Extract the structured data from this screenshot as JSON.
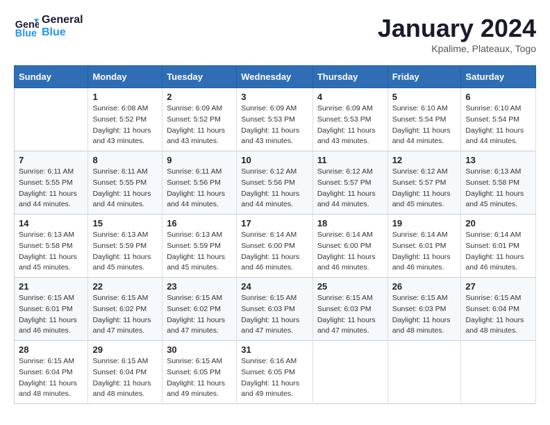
{
  "logo": {
    "line1": "General",
    "line2": "Blue"
  },
  "title": "January 2024",
  "subtitle": "Kpalime, Plateaux, Togo",
  "headers": [
    "Sunday",
    "Monday",
    "Tuesday",
    "Wednesday",
    "Thursday",
    "Friday",
    "Saturday"
  ],
  "weeks": [
    [
      {
        "day": "",
        "sunrise": "",
        "sunset": "",
        "daylight": ""
      },
      {
        "day": "1",
        "sunrise": "6:08 AM",
        "sunset": "5:52 PM",
        "daylight": "11 hours and 43 minutes."
      },
      {
        "day": "2",
        "sunrise": "6:09 AM",
        "sunset": "5:52 PM",
        "daylight": "11 hours and 43 minutes."
      },
      {
        "day": "3",
        "sunrise": "6:09 AM",
        "sunset": "5:53 PM",
        "daylight": "11 hours and 43 minutes."
      },
      {
        "day": "4",
        "sunrise": "6:09 AM",
        "sunset": "5:53 PM",
        "daylight": "11 hours and 43 minutes."
      },
      {
        "day": "5",
        "sunrise": "6:10 AM",
        "sunset": "5:54 PM",
        "daylight": "11 hours and 44 minutes."
      },
      {
        "day": "6",
        "sunrise": "6:10 AM",
        "sunset": "5:54 PM",
        "daylight": "11 hours and 44 minutes."
      }
    ],
    [
      {
        "day": "7",
        "sunrise": "6:11 AM",
        "sunset": "5:55 PM",
        "daylight": "11 hours and 44 minutes."
      },
      {
        "day": "8",
        "sunrise": "6:11 AM",
        "sunset": "5:55 PM",
        "daylight": "11 hours and 44 minutes."
      },
      {
        "day": "9",
        "sunrise": "6:11 AM",
        "sunset": "5:56 PM",
        "daylight": "11 hours and 44 minutes."
      },
      {
        "day": "10",
        "sunrise": "6:12 AM",
        "sunset": "5:56 PM",
        "daylight": "11 hours and 44 minutes."
      },
      {
        "day": "11",
        "sunrise": "6:12 AM",
        "sunset": "5:57 PM",
        "daylight": "11 hours and 44 minutes."
      },
      {
        "day": "12",
        "sunrise": "6:12 AM",
        "sunset": "5:57 PM",
        "daylight": "11 hours and 45 minutes."
      },
      {
        "day": "13",
        "sunrise": "6:13 AM",
        "sunset": "5:58 PM",
        "daylight": "11 hours and 45 minutes."
      }
    ],
    [
      {
        "day": "14",
        "sunrise": "6:13 AM",
        "sunset": "5:58 PM",
        "daylight": "11 hours and 45 minutes."
      },
      {
        "day": "15",
        "sunrise": "6:13 AM",
        "sunset": "5:59 PM",
        "daylight": "11 hours and 45 minutes."
      },
      {
        "day": "16",
        "sunrise": "6:13 AM",
        "sunset": "5:59 PM",
        "daylight": "11 hours and 45 minutes."
      },
      {
        "day": "17",
        "sunrise": "6:14 AM",
        "sunset": "6:00 PM",
        "daylight": "11 hours and 46 minutes."
      },
      {
        "day": "18",
        "sunrise": "6:14 AM",
        "sunset": "6:00 PM",
        "daylight": "11 hours and 46 minutes."
      },
      {
        "day": "19",
        "sunrise": "6:14 AM",
        "sunset": "6:01 PM",
        "daylight": "11 hours and 46 minutes."
      },
      {
        "day": "20",
        "sunrise": "6:14 AM",
        "sunset": "6:01 PM",
        "daylight": "11 hours and 46 minutes."
      }
    ],
    [
      {
        "day": "21",
        "sunrise": "6:15 AM",
        "sunset": "6:01 PM",
        "daylight": "11 hours and 46 minutes."
      },
      {
        "day": "22",
        "sunrise": "6:15 AM",
        "sunset": "6:02 PM",
        "daylight": "11 hours and 47 minutes."
      },
      {
        "day": "23",
        "sunrise": "6:15 AM",
        "sunset": "6:02 PM",
        "daylight": "11 hours and 47 minutes."
      },
      {
        "day": "24",
        "sunrise": "6:15 AM",
        "sunset": "6:03 PM",
        "daylight": "11 hours and 47 minutes."
      },
      {
        "day": "25",
        "sunrise": "6:15 AM",
        "sunset": "6:03 PM",
        "daylight": "11 hours and 47 minutes."
      },
      {
        "day": "26",
        "sunrise": "6:15 AM",
        "sunset": "6:03 PM",
        "daylight": "11 hours and 48 minutes."
      },
      {
        "day": "27",
        "sunrise": "6:15 AM",
        "sunset": "6:04 PM",
        "daylight": "11 hours and 48 minutes."
      }
    ],
    [
      {
        "day": "28",
        "sunrise": "6:15 AM",
        "sunset": "6:04 PM",
        "daylight": "11 hours and 48 minutes."
      },
      {
        "day": "29",
        "sunrise": "6:15 AM",
        "sunset": "6:04 PM",
        "daylight": "11 hours and 48 minutes."
      },
      {
        "day": "30",
        "sunrise": "6:15 AM",
        "sunset": "6:05 PM",
        "daylight": "11 hours and 49 minutes."
      },
      {
        "day": "31",
        "sunrise": "6:16 AM",
        "sunset": "6:05 PM",
        "daylight": "11 hours and 49 minutes."
      },
      {
        "day": "",
        "sunrise": "",
        "sunset": "",
        "daylight": ""
      },
      {
        "day": "",
        "sunrise": "",
        "sunset": "",
        "daylight": ""
      },
      {
        "day": "",
        "sunrise": "",
        "sunset": "",
        "daylight": ""
      }
    ]
  ],
  "labels": {
    "sunrise": "Sunrise:",
    "sunset": "Sunset:",
    "daylight": "Daylight:"
  }
}
